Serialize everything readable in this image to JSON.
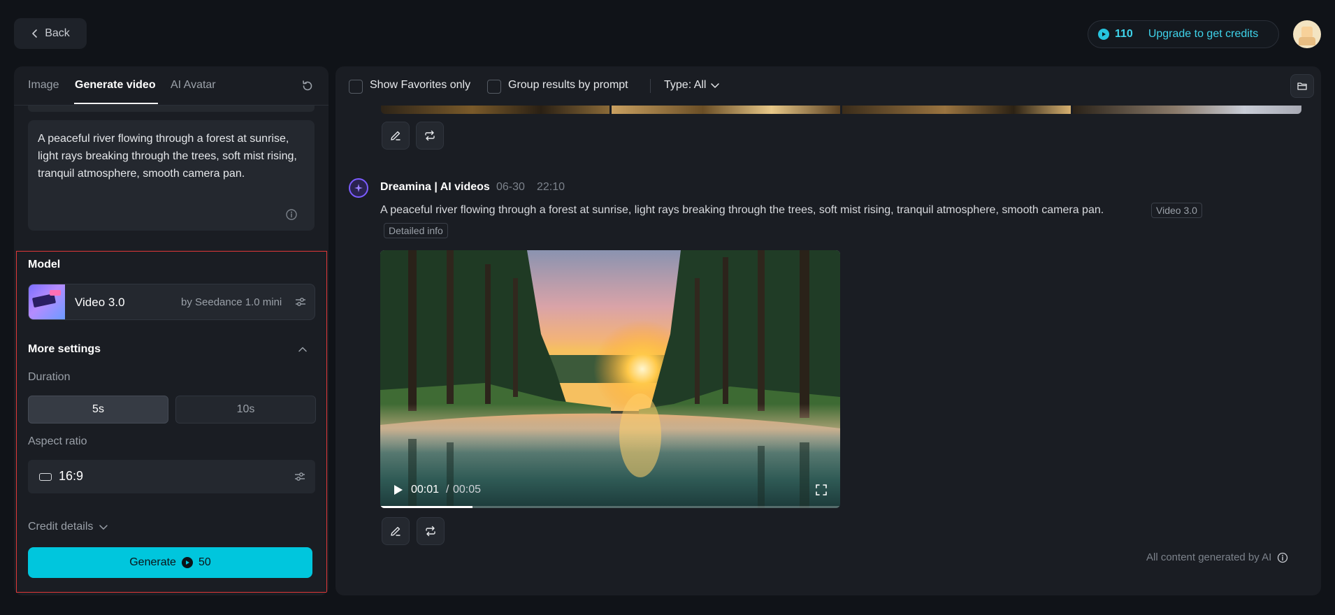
{
  "topbar": {
    "back_label": "Back",
    "credits": "110",
    "upgrade_label": "Upgrade to get credits"
  },
  "left": {
    "tabs": [
      {
        "label": "Image"
      },
      {
        "label": "Generate video"
      },
      {
        "label": "AI Avatar"
      }
    ],
    "active_tab": "Generate video",
    "prompt": "A peaceful river flowing through a forest at sunrise, light rays breaking through the trees, soft mist rising, tranquil atmosphere, smooth camera pan.",
    "model_title": "Model",
    "model_name": "Video 3.0",
    "model_sub": "by Seedance 1.0 mini",
    "more_settings": "More settings",
    "duration_label": "Duration",
    "durations": [
      "5s",
      "10s"
    ],
    "selected_duration": "5s",
    "aspect_label": "Aspect ratio",
    "aspect_value": "16:9",
    "credit_details": "Credit details",
    "generate_label": "Generate",
    "generate_cost": "50"
  },
  "right": {
    "filters": {
      "favorites": "Show Favorites only",
      "group": "Group results by prompt",
      "type": "Type: All"
    },
    "message": {
      "sender": "Dreamina | AI videos",
      "date": "06-30",
      "time": "22:10",
      "text": "A peaceful river flowing through a forest at sunrise, light rays breaking through the trees, soft mist rising, tranquil atmosphere, smooth camera pan.",
      "model_tag": "Video 3.0",
      "detail_tag": "Detailed info"
    },
    "video": {
      "current": "00:01",
      "separator": "/",
      "total": "00:05",
      "progress": 0.2
    },
    "footer": "All content generated by AI"
  },
  "colors": {
    "accent": "#00c6dd",
    "credit": "#3fd3ea",
    "panel": "#1a1d23",
    "background": "#101318",
    "highlight_border": "#e03838"
  },
  "icons": [
    "chevron-left-icon",
    "credit-coin-icon",
    "reset-icon",
    "info-icon",
    "settings-sliders-icon",
    "chevron-up-icon",
    "chevron-down-icon",
    "folder-icon",
    "edit-icon",
    "repeat-icon",
    "sparkle-icon",
    "play-icon",
    "fullscreen-icon"
  ]
}
